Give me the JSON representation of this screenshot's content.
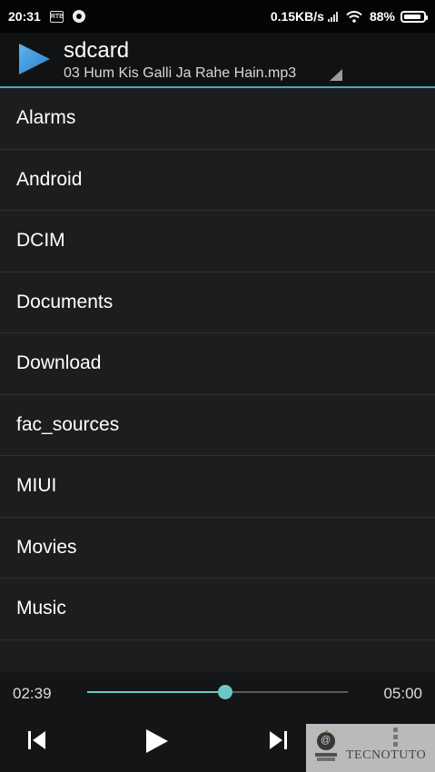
{
  "status_bar": {
    "time": "20:31",
    "notif_icon_text": "RTB",
    "net_speed": "0.15KB/s",
    "battery": "88%",
    "icons": [
      "sim-icon",
      "aperture-icon",
      "signal-icon",
      "wifi-icon",
      "battery-icon"
    ]
  },
  "header": {
    "title": "sdcard",
    "subtitle": "03 Hum Kis Galli Ja Rahe Hain.mp3",
    "accent_color": "#3a8fd0"
  },
  "folders": [
    "Alarms",
    "Android",
    "DCIM",
    "Documents",
    "Download",
    "fac_sources",
    "MIUI",
    "Movies",
    "Music"
  ],
  "player": {
    "elapsed": "02:39",
    "total": "05:00",
    "progress": 0.53,
    "accent_color": "#6cc6c6",
    "controls": [
      "skip-previous-icon",
      "play-icon",
      "skip-next-icon"
    ]
  },
  "watermark": {
    "text": "TECNOTUTO",
    "logo_char": "@"
  }
}
